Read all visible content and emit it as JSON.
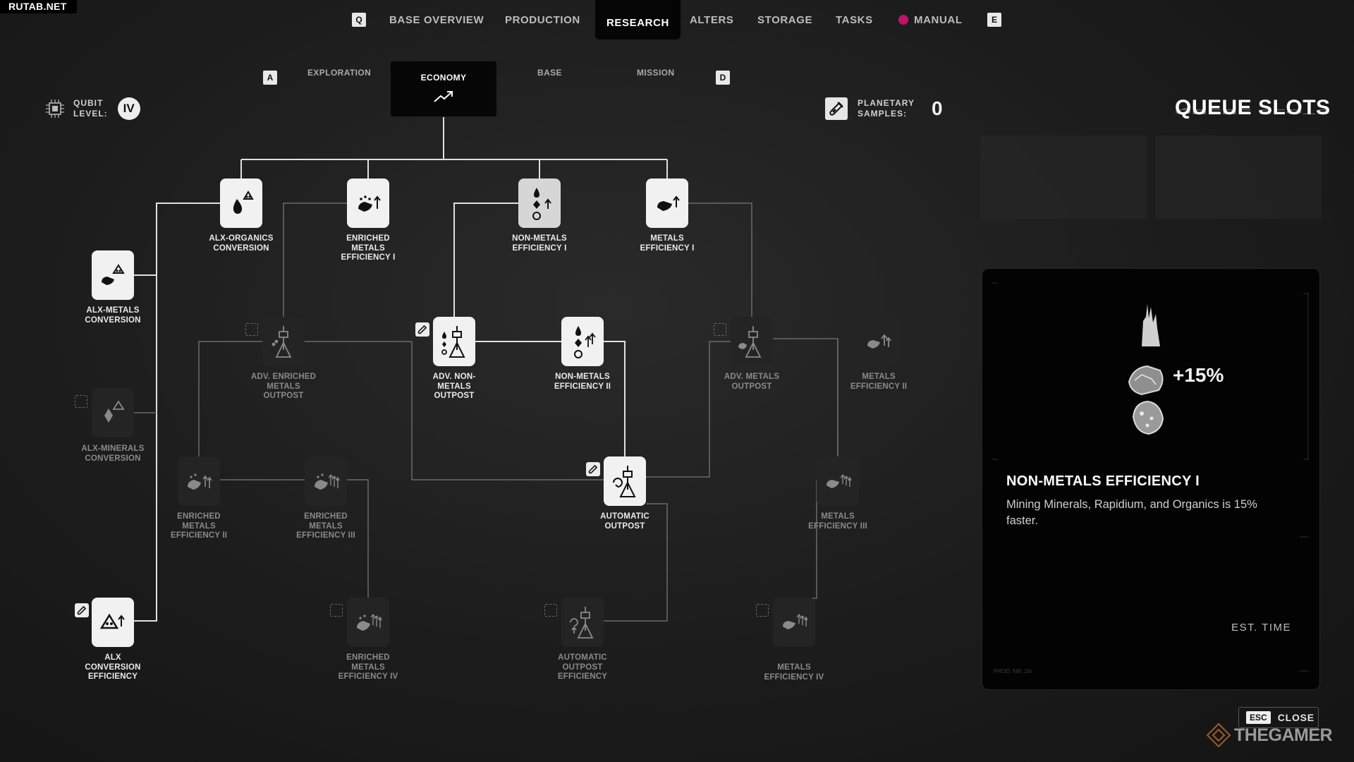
{
  "watermark": "RUTAB.NET",
  "nav": {
    "left_key": "Q",
    "right_key": "E",
    "items": [
      "BASE OVERVIEW",
      "PRODUCTION",
      "RESEARCH",
      "ALTERS",
      "STORAGE",
      "TASKS",
      "MANUAL"
    ],
    "active": "RESEARCH"
  },
  "subtabs": {
    "left_key": "A",
    "right_key": "D",
    "items": [
      "EXPLORATION",
      "ECONOMY",
      "BASE",
      "MISSION"
    ],
    "active": "ECONOMY"
  },
  "qubit": {
    "label_line1": "QUBIT",
    "label_line2": "LEVEL:",
    "value": "IV"
  },
  "planetary": {
    "label_line1": "PLANETARY",
    "label_line2": "SAMPLES:",
    "value": "0"
  },
  "queue": {
    "title": "QUEUE SLOTS"
  },
  "nodes": {
    "alx_organics": {
      "line1": "ALX-ORGANICS",
      "line2": "CONVERSION"
    },
    "enriched_1": {
      "line1": "ENRICHED",
      "line2": "METALS",
      "line3": "EFFICIENCY I"
    },
    "nonmetals_1": {
      "line1": "NON-METALS",
      "line2": "EFFICIENCY I"
    },
    "metals_1": {
      "line1": "METALS",
      "line2": "EFFICIENCY I"
    },
    "alx_metals": {
      "line1": "ALX-METALS",
      "line2": "CONVERSION"
    },
    "adv_enriched": {
      "line1": "ADV. ENRICHED",
      "line2": "METALS",
      "line3": "OUTPOST"
    },
    "adv_nonmetals": {
      "line1": "ADV. NON-",
      "line2": "METALS",
      "line3": "OUTPOST"
    },
    "nonmetals_2": {
      "line1": "NON-METALS",
      "line2": "EFFICIENCY II"
    },
    "adv_metals": {
      "line1": "ADV. METALS",
      "line2": "OUTPOST"
    },
    "metals_2": {
      "line1": "METALS",
      "line2": "EFFICIENCY II"
    },
    "alx_minerals": {
      "line1": "ALX-MINERALS",
      "line2": "CONVERSION"
    },
    "enriched_2": {
      "line1": "ENRICHED",
      "line2": "METALS",
      "line3": "EFFICIENCY II"
    },
    "enriched_3": {
      "line1": "ENRICHED",
      "line2": "METALS",
      "line3": "EFFICIENCY III"
    },
    "auto_outpost": {
      "line1": "AUTOMATIC",
      "line2": "OUTPOST"
    },
    "metals_3": {
      "line1": "METALS",
      "line2": "EFFICIENCY III"
    },
    "alx_conv_eff": {
      "line1": "ALX",
      "line2": "CONVERSION",
      "line3": "EFFICIENCY"
    },
    "enriched_4": {
      "line1": "ENRICHED",
      "line2": "METALS",
      "line3": "EFFICIENCY IV"
    },
    "auto_outpost_eff": {
      "line1": "AUTOMATIC",
      "line2": "OUTPOST",
      "line3": "EFFICIENCY"
    },
    "metals_4": {
      "line1": "METALS",
      "line2": "EFFICIENCY IV"
    }
  },
  "detail": {
    "title": "NON-METALS EFFICIENCY I",
    "description": "Mining Minerals, Rapidium, and Organics is 15% faster.",
    "bonus": "+15%",
    "est_time_label": "EST. TIME",
    "prod_code": "PROD. NR. 24/"
  },
  "close": {
    "key": "ESC",
    "label": "CLOSE"
  },
  "brand": "THEGAMER"
}
